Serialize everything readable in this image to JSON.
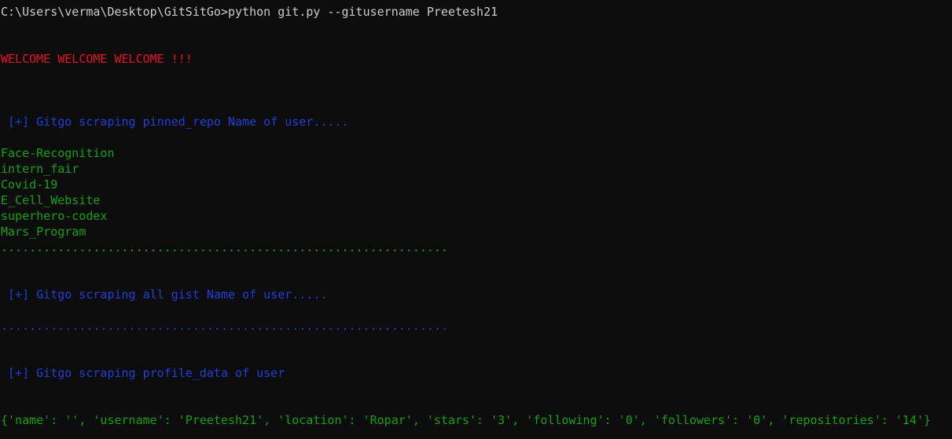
{
  "terminal": {
    "command_line": "C:\\Users\\verma\\Desktop\\GitSitGo>python git.py --gitusername Preetesh21",
    "welcome": "WELCOME WELCOME WELCOME !!!",
    "section_pinned_header": " [+] Gitgo scraping pinned_repo Name of user.....",
    "pinned_repos": [
      "Face-Recognition",
      "intern_fair",
      "Covid-19",
      "E_Cell_Website",
      "superhero-codex",
      "Mars_Program"
    ],
    "divider_green": "...............................................................",
    "section_gist_header": " [+] Gitgo scraping all gist Name of user.....",
    "divider_blue": "...............................................................",
    "section_profile_header": " [+] Gitgo scraping profile_data of user",
    "profile_output": "{'name': '', 'username': 'Preetesh21', 'location': 'Ropar', 'stars': '3', 'following': '0', 'followers': '0', 'repositories': '14'}"
  },
  "colors": {
    "background": "#0c0c0c",
    "default_text": "#cccccc",
    "welcome_text": "#e81123",
    "section_header_text": "#1f3fd8",
    "repo_list_text": "#13a10e"
  }
}
